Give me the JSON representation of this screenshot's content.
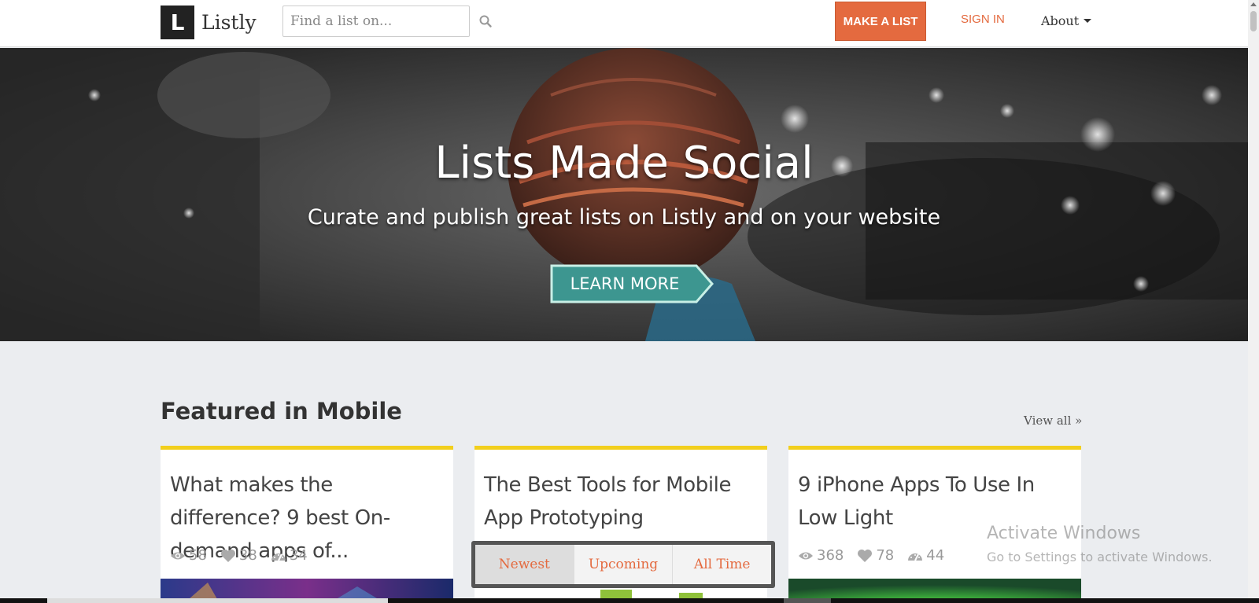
{
  "header": {
    "logo_letter": "L",
    "brand": "Listly",
    "search_placeholder": "Find a list on...",
    "make_list_label": "MAKE A LIST",
    "sign_in_label": "SIGN IN",
    "about_label": "About",
    "accent_color": "#e46a3f"
  },
  "hero": {
    "title": "Lists Made Social",
    "subtitle": "Curate and publish great lists on Listly and on your website",
    "cta_label": "LEARN MORE",
    "cta_color": "#3d9690"
  },
  "featured": {
    "heading": "Featured in Mobile",
    "view_all_label": "View all »",
    "cards": [
      {
        "title": "What makes the difference? 9 best On-demand apps of...",
        "views": "58",
        "likes": "38",
        "score": "34"
      },
      {
        "title": "The Best Tools for Mobile App Prototyping"
      },
      {
        "title": "9 iPhone Apps To Use In Low Light",
        "views": "368",
        "likes": "78",
        "score": "44"
      }
    ]
  },
  "tabs": {
    "items": [
      "Newest",
      "Upcoming",
      "All Time"
    ]
  },
  "watermark": {
    "line1": "Activate Windows",
    "line2": "Go to Settings to activate Windows."
  }
}
